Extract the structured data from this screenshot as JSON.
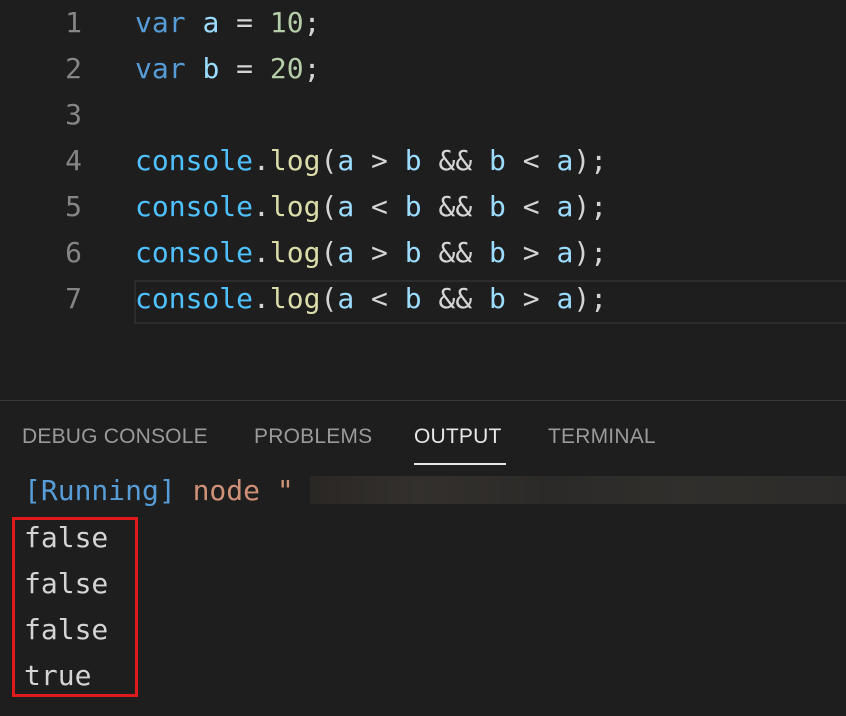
{
  "editor": {
    "lines": [
      {
        "number": "1",
        "tokens": [
          {
            "t": "var",
            "c": "kw"
          },
          {
            "t": " ",
            "c": "op"
          },
          {
            "t": "a",
            "c": "var"
          },
          {
            "t": " = ",
            "c": "op"
          },
          {
            "t": "10",
            "c": "num"
          },
          {
            "t": ";",
            "c": "op"
          }
        ]
      },
      {
        "number": "2",
        "tokens": [
          {
            "t": "var",
            "c": "kw"
          },
          {
            "t": " ",
            "c": "op"
          },
          {
            "t": "b",
            "c": "var"
          },
          {
            "t": " = ",
            "c": "op"
          },
          {
            "t": "20",
            "c": "num"
          },
          {
            "t": ";",
            "c": "op"
          }
        ]
      },
      {
        "number": "3",
        "tokens": []
      },
      {
        "number": "4",
        "tokens": [
          {
            "t": "console",
            "c": "obj"
          },
          {
            "t": ".",
            "c": "op"
          },
          {
            "t": "log",
            "c": "fn"
          },
          {
            "t": "(",
            "c": "op"
          },
          {
            "t": "a",
            "c": "var"
          },
          {
            "t": " > ",
            "c": "op"
          },
          {
            "t": "b",
            "c": "var"
          },
          {
            "t": " && ",
            "c": "op"
          },
          {
            "t": "b",
            "c": "var"
          },
          {
            "t": " < ",
            "c": "op"
          },
          {
            "t": "a",
            "c": "var"
          },
          {
            "t": ");",
            "c": "op"
          }
        ]
      },
      {
        "number": "5",
        "tokens": [
          {
            "t": "console",
            "c": "obj"
          },
          {
            "t": ".",
            "c": "op"
          },
          {
            "t": "log",
            "c": "fn"
          },
          {
            "t": "(",
            "c": "op"
          },
          {
            "t": "a",
            "c": "var"
          },
          {
            "t": " < ",
            "c": "op"
          },
          {
            "t": "b",
            "c": "var"
          },
          {
            "t": " && ",
            "c": "op"
          },
          {
            "t": "b",
            "c": "var"
          },
          {
            "t": " < ",
            "c": "op"
          },
          {
            "t": "a",
            "c": "var"
          },
          {
            "t": ");",
            "c": "op"
          }
        ]
      },
      {
        "number": "6",
        "tokens": [
          {
            "t": "console",
            "c": "obj"
          },
          {
            "t": ".",
            "c": "op"
          },
          {
            "t": "log",
            "c": "fn"
          },
          {
            "t": "(",
            "c": "op"
          },
          {
            "t": "a",
            "c": "var"
          },
          {
            "t": " > ",
            "c": "op"
          },
          {
            "t": "b",
            "c": "var"
          },
          {
            "t": " && ",
            "c": "op"
          },
          {
            "t": "b",
            "c": "var"
          },
          {
            "t": " > ",
            "c": "op"
          },
          {
            "t": "a",
            "c": "var"
          },
          {
            "t": ");",
            "c": "op"
          }
        ]
      },
      {
        "number": "7",
        "tokens": [
          {
            "t": "console",
            "c": "obj"
          },
          {
            "t": ".",
            "c": "op"
          },
          {
            "t": "log",
            "c": "fn"
          },
          {
            "t": "(",
            "c": "op"
          },
          {
            "t": "a",
            "c": "var"
          },
          {
            "t": " < ",
            "c": "op"
          },
          {
            "t": "b",
            "c": "var"
          },
          {
            "t": " && ",
            "c": "op"
          },
          {
            "t": "b",
            "c": "var"
          },
          {
            "t": " > ",
            "c": "op"
          },
          {
            "t": "a",
            "c": "var"
          },
          {
            "t": ");",
            "c": "op"
          }
        ]
      }
    ]
  },
  "panel": {
    "tabs": [
      {
        "label": "DEBUG CONSOLE",
        "active": false
      },
      {
        "label": "PROBLEMS",
        "active": false
      },
      {
        "label": "OUTPUT",
        "active": true
      },
      {
        "label": "TERMINAL",
        "active": false
      }
    ],
    "output": {
      "running_label": "[Running]",
      "command": " node \"",
      "results": [
        "false",
        "false",
        "false",
        "true"
      ]
    }
  },
  "colors": {
    "background": "#1e1e1e",
    "keyword": "#569cd6",
    "variable": "#9cdcfe",
    "number": "#b5cea8",
    "object": "#4fc1ff",
    "function": "#dcdcaa",
    "string": "#ce9178",
    "highlight_border": "#e0191b"
  }
}
